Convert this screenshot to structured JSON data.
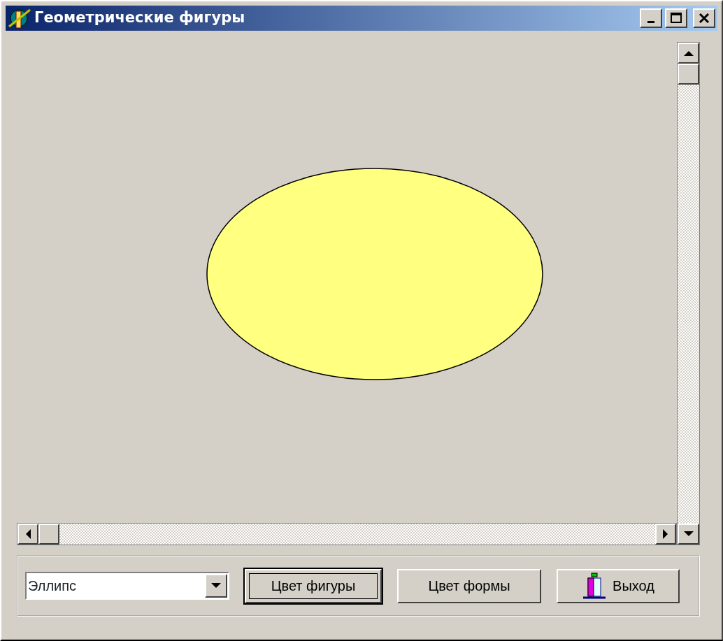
{
  "window": {
    "title": "Геометрические фигуры"
  },
  "canvas": {
    "shape": {
      "kind": "ellipse"
    }
  },
  "shape_select": {
    "value": "Эллипс"
  },
  "buttons": [
    {
      "label": "Цвет фигуры",
      "kind": "plain",
      "focused": true
    },
    {
      "label": "Цвет формы",
      "kind": "plain",
      "focused": false
    },
    {
      "label": "Выход",
      "kind": "exit",
      "focused": false
    }
  ]
}
